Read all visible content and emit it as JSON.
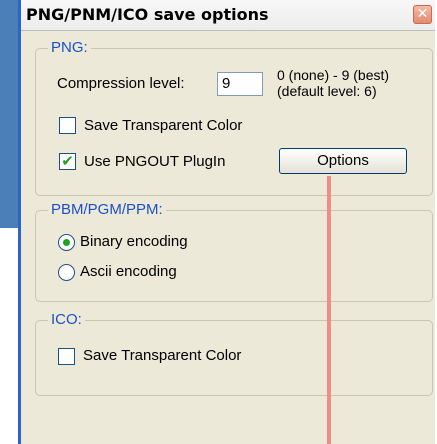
{
  "dialog": {
    "title": "PNG/PNM/ICO save options",
    "close_glyph": "✕"
  },
  "png": {
    "legend": "PNG:",
    "compression_label": "Compression level:",
    "compression_value": "9",
    "range_hint_line1": "0 (none) - 9 (best)",
    "range_hint_line2": "(default level: 6)",
    "save_transparent_label": "Save Transparent Color",
    "save_transparent_checked": false,
    "use_pngout_label": "Use PNGOUT PlugIn",
    "use_pngout_checked": true,
    "options_button": "Options"
  },
  "pnm": {
    "legend": "PBM/PGM/PPM:",
    "binary_label": "Binary encoding",
    "ascii_label": "Ascii encoding",
    "selected": "binary"
  },
  "ico": {
    "legend": "ICO:",
    "save_transparent_label": "Save Transparent Color",
    "save_transparent_checked": false
  },
  "icons": {
    "check_glyph": "✔"
  }
}
